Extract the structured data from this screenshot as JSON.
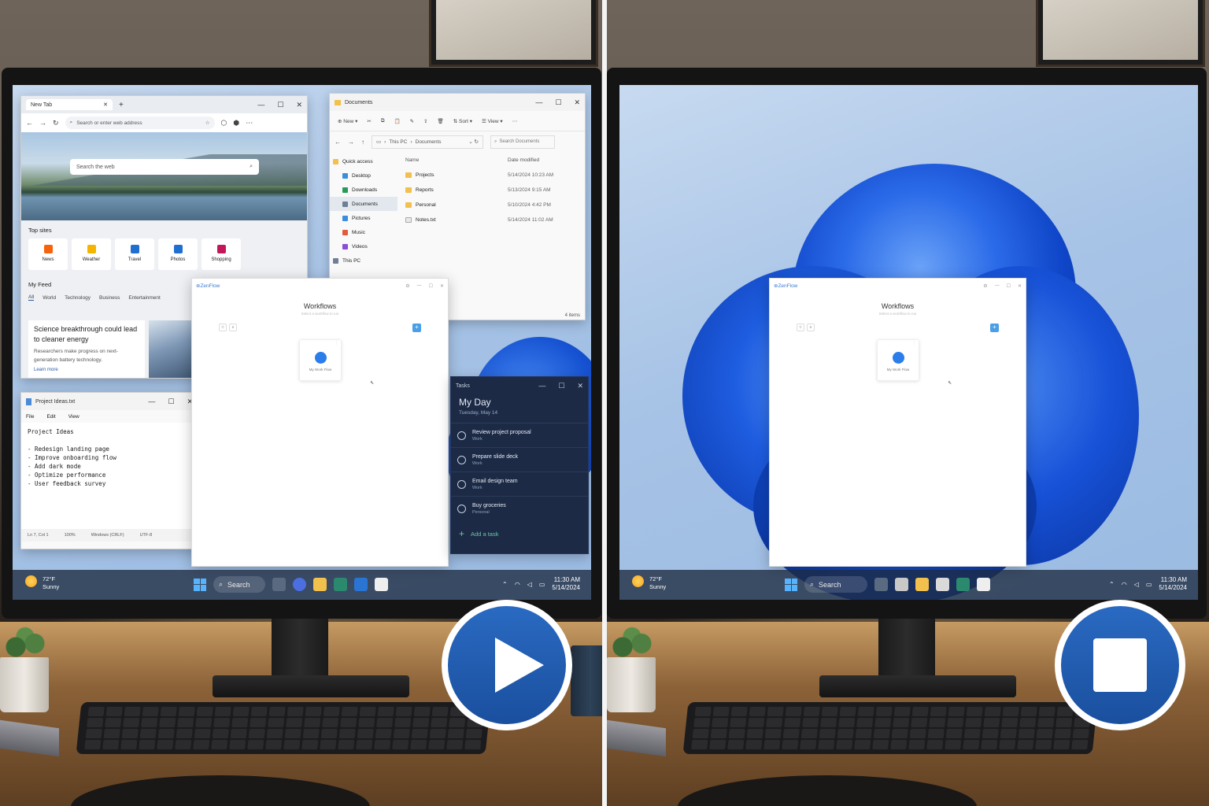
{
  "left": {
    "edge": {
      "tab_label": "New Tab",
      "address_placeholder": "Search or enter web address",
      "search_placeholder": "Search the web",
      "top_sites_label": "Top sites",
      "top_sites": [
        {
          "label": "News",
          "icon": "news-icon",
          "color": "#f7630c"
        },
        {
          "label": "Weather",
          "icon": "weather-icon",
          "color": "#f5b400"
        },
        {
          "label": "Travel",
          "icon": "travel-icon",
          "color": "#1f6fd1"
        },
        {
          "label": "Photos",
          "icon": "photos-icon",
          "color": "#1f6fd1"
        },
        {
          "label": "Shopping",
          "icon": "shopping-icon",
          "color": "#c2185b"
        }
      ],
      "feed_label": "My Feed",
      "feed_tabs": [
        "All",
        "World",
        "Technology",
        "Business",
        "Entertainment"
      ],
      "article_title": "Science breakthrough could lead to cleaner energy",
      "article_body": "Researchers make progress on next-generation battery technology.",
      "article_link": "Learn more"
    },
    "explorer": {
      "title": "Documents",
      "toolbar_new": "New",
      "toolbar_sort": "Sort",
      "toolbar_view": "View",
      "breadcrumb": [
        "This PC",
        "Documents"
      ],
      "search_placeholder": "Search Documents",
      "nav": [
        "Quick access",
        "Desktop",
        "Downloads",
        "Documents",
        "Pictures",
        "Music",
        "Videos",
        "This PC"
      ],
      "col_name": "Name",
      "col_date": "Date modified",
      "files": [
        {
          "name": "Projects",
          "date": "5/14/2024 10:23 AM",
          "type": "folder"
        },
        {
          "name": "Reports",
          "date": "5/13/2024 9:15 AM",
          "type": "folder"
        },
        {
          "name": "Personal",
          "date": "5/10/2024 4:42 PM",
          "type": "folder"
        },
        {
          "name": "Notes.txt",
          "date": "5/14/2024 11:02 AM",
          "type": "file"
        }
      ],
      "status": "4 items"
    },
    "notepad": {
      "title": "Project Ideas.txt",
      "menu": [
        "File",
        "Edit",
        "View"
      ],
      "lines": [
        "Project Ideas",
        "",
        "- Redesign landing page",
        "- Improve onboarding flow",
        "- Add dark mode",
        "- Optimize performance",
        "- User feedback survey"
      ],
      "status": [
        "Ln 7, Col 1",
        "100%",
        "Windows (CRLF)",
        "UTF-8"
      ]
    },
    "tasks": {
      "app": "Tasks",
      "heading": "My Day",
      "date": "Tuesday, May 14",
      "items": [
        {
          "title": "Review project proposal",
          "list": "Work"
        },
        {
          "title": "Prepare slide deck",
          "list": "Work"
        },
        {
          "title": "Email design team",
          "list": "Work"
        },
        {
          "title": "Buy groceries",
          "list": "Personal"
        }
      ],
      "add_label": "Add a task"
    }
  },
  "zenflow": {
    "app_name": "ZenFlow",
    "title": "Workflows",
    "subtitle": "Select a workflow to run",
    "card_label": "My Work Flow"
  },
  "taskbar": {
    "temp": "72°F",
    "condition": "Sunny",
    "search_label": "Search",
    "time": "11:30 AM",
    "date": "5/14/2024"
  },
  "buttons": {
    "left": "play-icon",
    "right": "stop-icon"
  },
  "colors": {
    "accent": "#1a56a8",
    "tasks_bg": "#1c2a45",
    "wallpaper_blue": "#1b5fe0"
  }
}
